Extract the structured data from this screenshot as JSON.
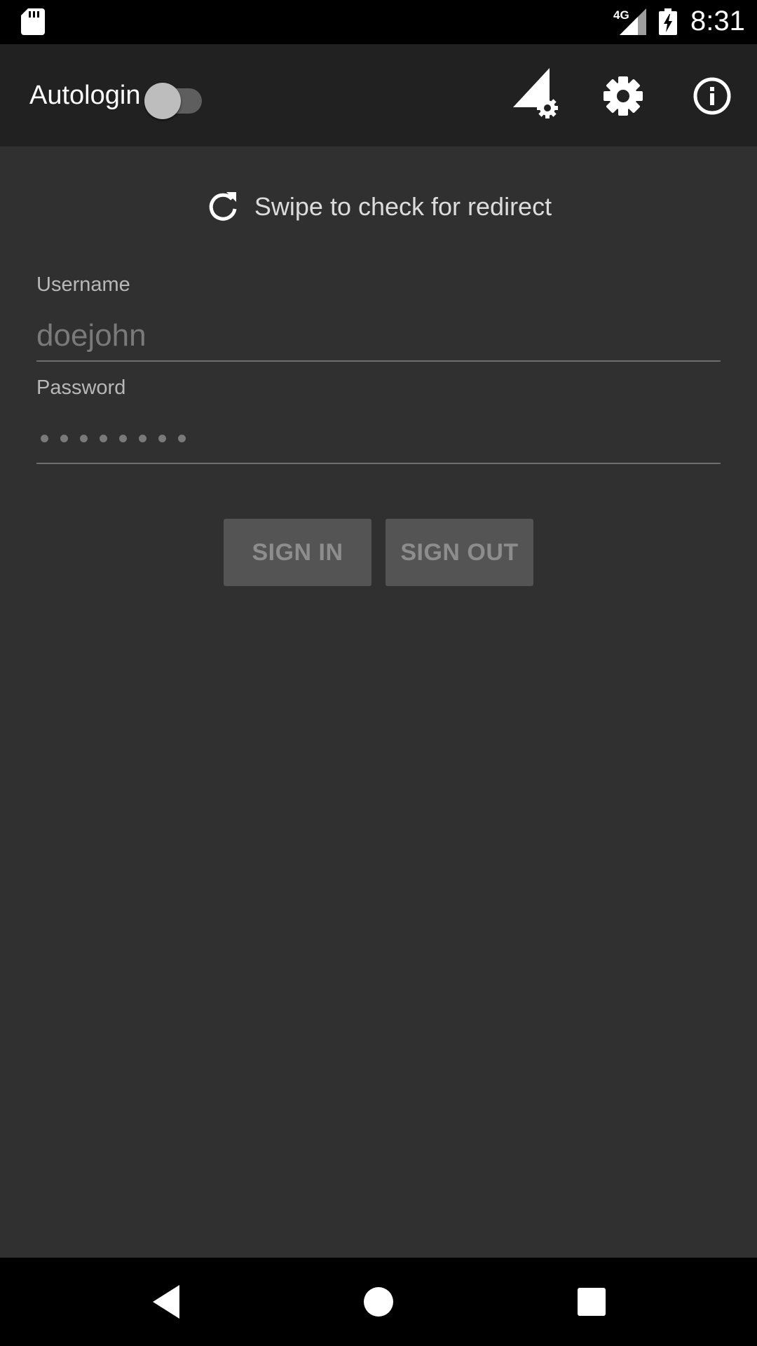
{
  "status_bar": {
    "network": "4G",
    "time": "8:31",
    "icons": [
      "sd-card-icon",
      "cell-signal-icon",
      "battery-charging-icon"
    ]
  },
  "app_bar": {
    "autologin_label": "Autologin",
    "autologin_enabled": false,
    "actions": [
      "signal-settings-icon",
      "gear-icon",
      "info-icon"
    ]
  },
  "content": {
    "refresh_hint": "Swipe to check for redirect",
    "username_label": "Username",
    "username_placeholder": "doejohn",
    "password_label": "Password",
    "password_dot_count": 8,
    "sign_in_label": "SIGN IN",
    "sign_out_label": "SIGN OUT"
  },
  "colors": {
    "background": "#303030",
    "app_bar": "#212121",
    "button": "#545454",
    "button_text": "#8d8d8d"
  },
  "nav_bar": {
    "buttons": [
      "back-icon",
      "home-icon",
      "recents-icon"
    ]
  }
}
